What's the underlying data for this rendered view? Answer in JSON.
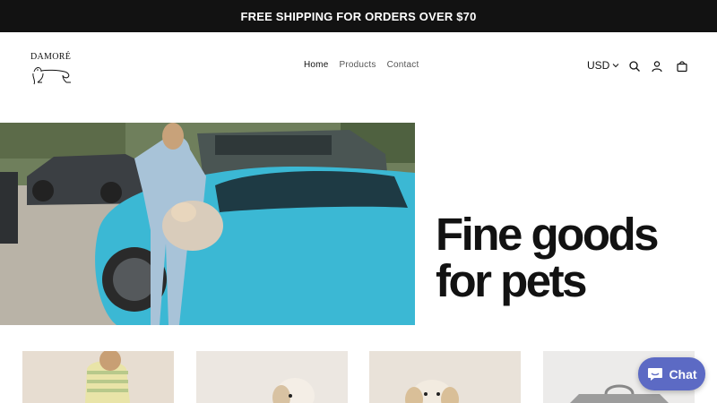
{
  "announcement": {
    "text": "FREE SHIPPING FOR ORDERS OVER $70"
  },
  "header": {
    "logo_text": "DAMORÉ",
    "nav": [
      {
        "label": "Home",
        "active": true
      },
      {
        "label": "Products",
        "active": false
      },
      {
        "label": "Contact",
        "active": false
      }
    ],
    "currency": "USD",
    "icons": [
      "chevron-down-icon",
      "search-icon",
      "account-icon",
      "cart-icon"
    ]
  },
  "hero": {
    "title_line1": "Fine goods",
    "title_line2": "for pets"
  },
  "chat": {
    "label": "Chat"
  },
  "colors": {
    "announcement_bg": "#121212",
    "hero_text": "#121212",
    "chat_bg": "#5c6ac4",
    "car_blue": "#3bb8d4"
  }
}
